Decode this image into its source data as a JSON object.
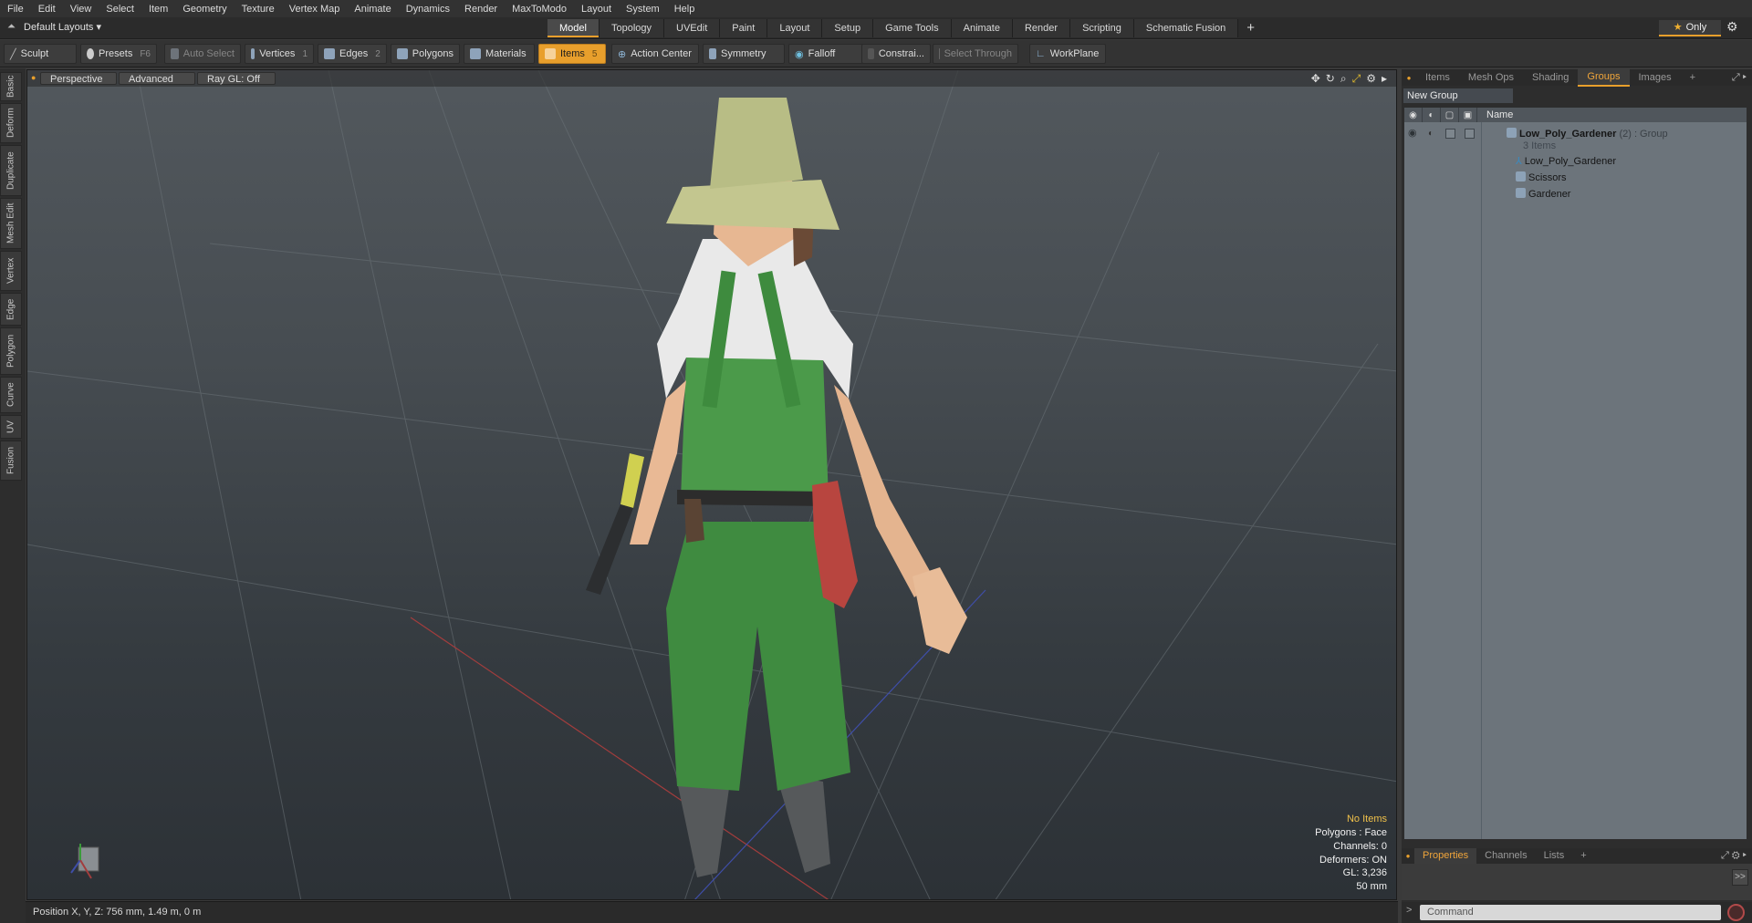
{
  "menu": [
    "File",
    "Edit",
    "View",
    "Select",
    "Item",
    "Geometry",
    "Texture",
    "Vertex Map",
    "Animate",
    "Dynamics",
    "Render",
    "MaxToModo",
    "Layout",
    "System",
    "Help"
  ],
  "layout_selector": "Default Layouts ▾",
  "layout_tabs": [
    "Model",
    "Topology",
    "UVEdit",
    "Paint",
    "Layout",
    "Setup",
    "Game Tools",
    "Animate",
    "Render",
    "Scripting",
    "Schematic Fusion"
  ],
  "active_layout_tab": "Model",
  "only_label": "Only",
  "toolbar": {
    "sculpt": "Sculpt",
    "presets": "Presets",
    "presets_key": "F6",
    "auto_select": "Auto Select",
    "vertices": "Vertices",
    "vertices_key": "1",
    "edges": "Edges",
    "edges_key": "2",
    "polygons": "Polygons",
    "materials": "Materials",
    "items": "Items",
    "items_key": "5",
    "action_center": "Action Center",
    "symmetry": "Symmetry",
    "falloff": "Falloff",
    "constraints": "Constrai...",
    "select_through": "Select Through",
    "workplane": "WorkPlane"
  },
  "left_tabs": [
    "Basic",
    "Deform",
    "Duplicate",
    "Mesh Edit",
    "Vertex",
    "Edge",
    "Polygon",
    "Curve",
    "UV",
    "Fusion"
  ],
  "viewport": {
    "view_mode": "Perspective",
    "shading": "Advanced",
    "raygl": "Ray GL: Off",
    "stats": {
      "no_items": "No Items",
      "polygons": "Polygons : Face",
      "channels": "Channels: 0",
      "deformers": "Deformers: ON",
      "gl": "GL: 3,236",
      "focal": "50 mm"
    }
  },
  "status": "Position X, Y, Z:   756 mm, 1.49 m, 0 m",
  "right_panel": {
    "tabs": [
      "Items",
      "Mesh Ops",
      "Shading",
      "Groups",
      "Images"
    ],
    "active_tab": "Groups",
    "new_group": "New Group",
    "name_header": "Name",
    "group": {
      "name": "Low_Poly_Gardener",
      "badge": "(2) : Group",
      "count": "3 Items",
      "children": [
        "Low_Poly_Gardener",
        "Scissors",
        "Gardener"
      ]
    }
  },
  "bottom_tabs": [
    "Properties",
    "Channels",
    "Lists"
  ],
  "active_bottom_tab": "Properties",
  "command_placeholder": "Command",
  "colors": {
    "accent": "#e89f2c",
    "shirt": "#e8e8e8",
    "overalls": "#3d8a3e",
    "hat": "#b8c08a",
    "skin": "#e9b995",
    "pouch": "#b8453f"
  }
}
